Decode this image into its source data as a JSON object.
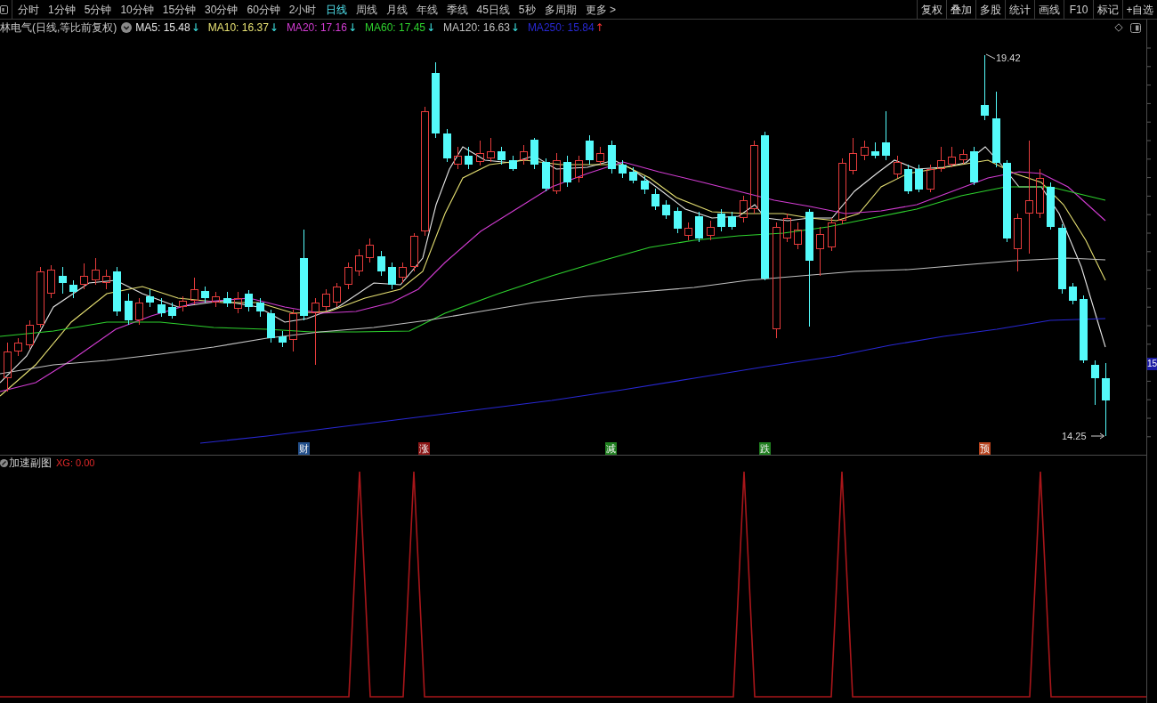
{
  "toolbar": {
    "periods": [
      {
        "label": "分时",
        "selected": false
      },
      {
        "label": "1分钟",
        "selected": false
      },
      {
        "label": "5分钟",
        "selected": false
      },
      {
        "label": "10分钟",
        "selected": false
      },
      {
        "label": "15分钟",
        "selected": false
      },
      {
        "label": "30分钟",
        "selected": false
      },
      {
        "label": "60分钟",
        "selected": false
      },
      {
        "label": "2小时",
        "selected": false
      },
      {
        "label": "日线",
        "selected": true
      },
      {
        "label": "周线",
        "selected": false
      },
      {
        "label": "月线",
        "selected": false
      },
      {
        "label": "年线",
        "selected": false
      },
      {
        "label": "季线",
        "selected": false
      },
      {
        "label": "45日线",
        "selected": false
      },
      {
        "label": "5秒",
        "selected": false
      },
      {
        "label": "多周期",
        "selected": false
      },
      {
        "label": "更多 >",
        "selected": false
      }
    ],
    "actions": [
      "复权",
      "叠加",
      "多股",
      "统计",
      "画线",
      "F10",
      "标记",
      "+自选"
    ]
  },
  "legend": {
    "title": "林电气(日线,等比前复权)",
    "moving_averages": [
      {
        "label": "MA5: 15.48",
        "color": "#e6e6e6",
        "arrow": "↓",
        "rising": false
      },
      {
        "label": "MA10: 16.37",
        "color": "#e6e072",
        "arrow": "↓",
        "rising": false
      },
      {
        "label": "MA20: 17.16",
        "color": "#d23cd2",
        "arrow": "↓",
        "rising": false
      },
      {
        "label": "MA60: 17.45",
        "color": "#2ed22e",
        "arrow": "↓",
        "rising": false
      },
      {
        "label": "MA120: 16.63",
        "color": "#c0c0c0",
        "arrow": "↓",
        "rising": false
      },
      {
        "label": "MA250: 15.84",
        "color": "#2828d2",
        "arrow": "↑",
        "rising": true
      }
    ]
  },
  "chart": {
    "signals": [
      {
        "label": "财",
        "color": "#23508c"
      },
      {
        "label": "涨",
        "color": "#8c1616"
      },
      {
        "label": "减",
        "color": "#1f7f1f"
      },
      {
        "label": "跌",
        "color": "#1f7f1f"
      },
      {
        "label": "预",
        "color": "#b8421c"
      }
    ],
    "high_label": "19.42",
    "low_label": "14.25",
    "axis_marker": "15"
  },
  "indicator_pane": {
    "title": "加速副图",
    "value": "XG: 0.00"
  }
}
